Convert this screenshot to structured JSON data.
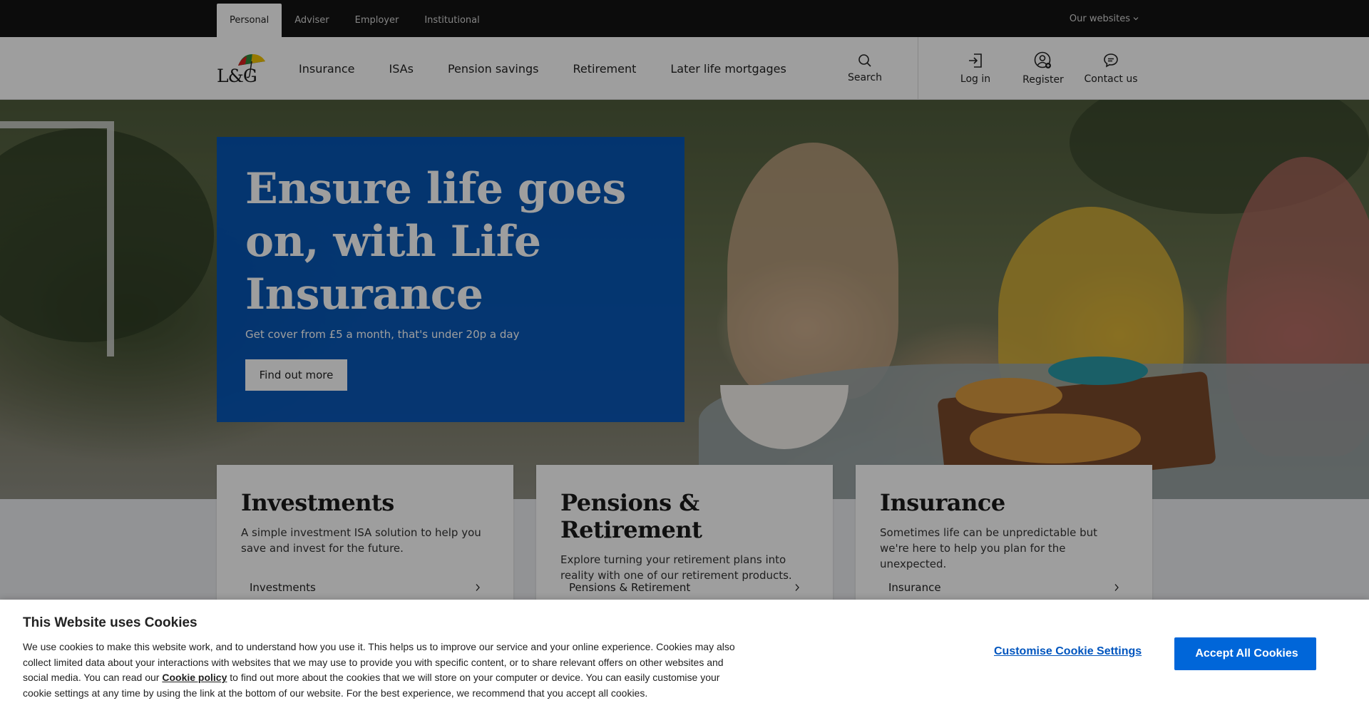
{
  "topbar": {
    "audiences": [
      {
        "label": "Personal",
        "active": true
      },
      {
        "label": "Adviser",
        "active": false
      },
      {
        "label": "Employer",
        "active": false
      },
      {
        "label": "Institutional",
        "active": false
      }
    ],
    "our_websites": "Our websites",
    "our_websites_icon": "chevron-down-icon"
  },
  "header": {
    "logo_text": "L&G",
    "logo_icon": "umbrella-logo",
    "nav": [
      "Insurance",
      "ISAs",
      "Pension savings",
      "Retirement",
      "Later life mortgages"
    ],
    "search_label": "Search",
    "login_label": "Log in",
    "register_label": "Register",
    "contact_label": "Contact us"
  },
  "hero": {
    "title": "Ensure life goes on, with Life Insurance",
    "subtitle": "Get cover from £5 a month, that's under 20p a day",
    "button_label": "Find out more"
  },
  "cards": [
    {
      "title": "Investments",
      "text": "A simple investment ISA solution to help you save and invest for the future.",
      "link_label": "Investments"
    },
    {
      "title": "Pensions & Retirement",
      "text": "Explore turning your retirement plans into reality with one of our retirement products.",
      "link_label": "Pensions & Retirement"
    },
    {
      "title": "Insurance",
      "text": "Sometimes life can be unpredictable but we're here to help you plan for the unexpected.",
      "link_label": "Insurance"
    }
  ],
  "cookie": {
    "title": "This Website uses Cookies",
    "text_before_link": "We use cookies to make this website work, and to understand how you use it. This helps us to improve our service and your online experience. Cookies may also collect limited data about your interactions with websites that we may use to provide you with specific content, or to share relevant offers on other websites and social media. You can read our ",
    "link_label": "Cookie policy",
    "text_after_link": " to find out more about the cookies that we will store on your computer or device. You can easily customise your cookie settings at any time by using the link at the bottom of our website. For the best experience, we recommend that you accept all cookies.",
    "customise_label": "Customise Cookie Settings",
    "accept_icon_glyph": "",
    "accept_label": "Accept All Cookies"
  },
  "colors": {
    "brand_blue": "#0055be",
    "accept_blue": "#0066d9",
    "topbar_bg": "#141414"
  }
}
